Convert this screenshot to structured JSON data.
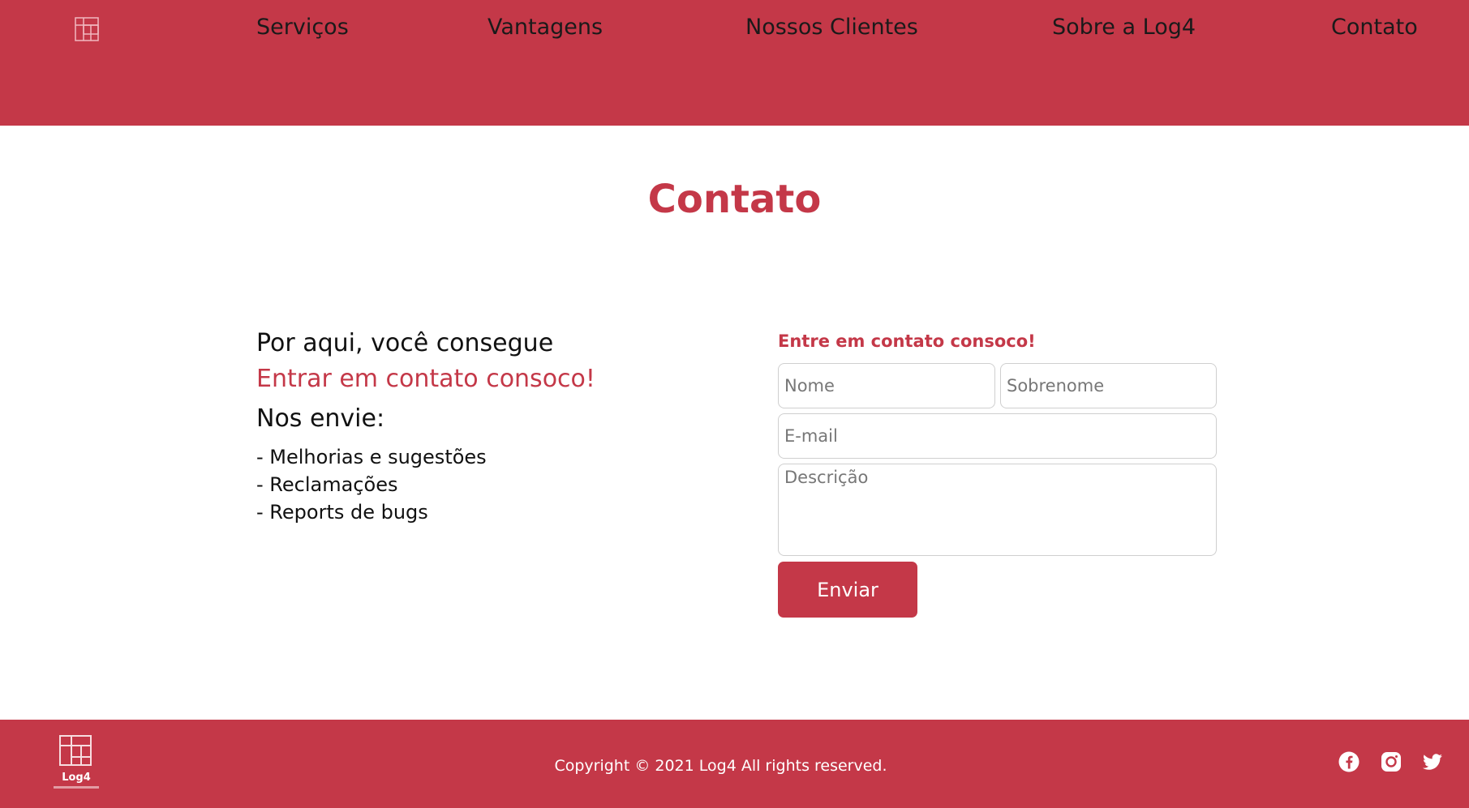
{
  "header": {
    "logo_icon": "log4-grid-icon",
    "nav": [
      {
        "label": "Serviços"
      },
      {
        "label": "Vantagens"
      },
      {
        "label": "Nossos Clientes"
      },
      {
        "label": "Sobre a Log4"
      },
      {
        "label": "Contato"
      }
    ]
  },
  "main": {
    "title": "Contato",
    "intro": {
      "line1": "Por aqui, você consegue",
      "line2": "Entrar em contato consoco!",
      "line3": "Nos envie:",
      "items": [
        "- Melhorias e sugestões",
        "- Reclamações",
        "- Reports de bugs"
      ]
    },
    "form": {
      "title": "Entre em contato consoco!",
      "nome_placeholder": "Nome",
      "sobrenome_placeholder": "Sobrenome",
      "email_placeholder": "E-mail",
      "descricao_placeholder": "Descrição",
      "submit_label": "Enviar"
    }
  },
  "footer": {
    "logo_name": "Log4",
    "copyright": "Copyright © 2021 Log4 All rights reserved.",
    "social": [
      "facebook-icon",
      "instagram-icon",
      "twitter-icon"
    ]
  },
  "colors": {
    "brand": "#c43848",
    "text": "#111111",
    "white": "#ffffff"
  }
}
